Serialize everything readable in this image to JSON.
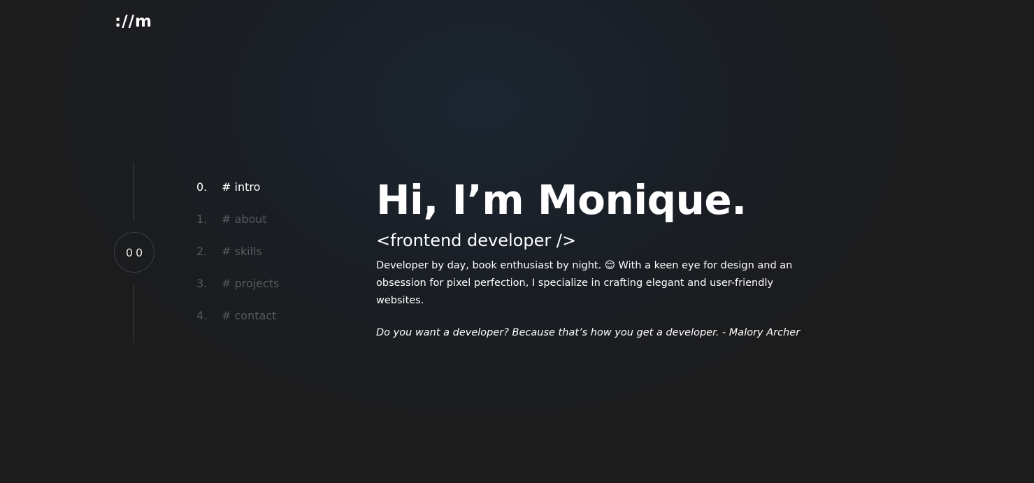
{
  "logo": ":/​/m",
  "section_counter": "00",
  "nav": {
    "items": [
      {
        "num": "0.",
        "label": "# intro"
      },
      {
        "num": "1.",
        "label": "# about"
      },
      {
        "num": "2.",
        "label": "# skills"
      },
      {
        "num": "3.",
        "label": "# projects"
      },
      {
        "num": "4.",
        "label": "# contact"
      }
    ]
  },
  "hero": {
    "heading": "Hi, I’m Monique.",
    "subheading": "<frontend developer />",
    "description": "Developer by day, book enthusiast by night. 😌 With a keen eye for design and an obsession for pixel perfection, I specialize in crafting elegant and user-friendly websites.",
    "quote": "Do you want a developer? Because that’s how you get a developer. - Malory Archer"
  },
  "colors": {
    "background": "#1c1c1c",
    "text": "#ffffff",
    "muted": "#56595d",
    "line": "#3c3f43"
  }
}
